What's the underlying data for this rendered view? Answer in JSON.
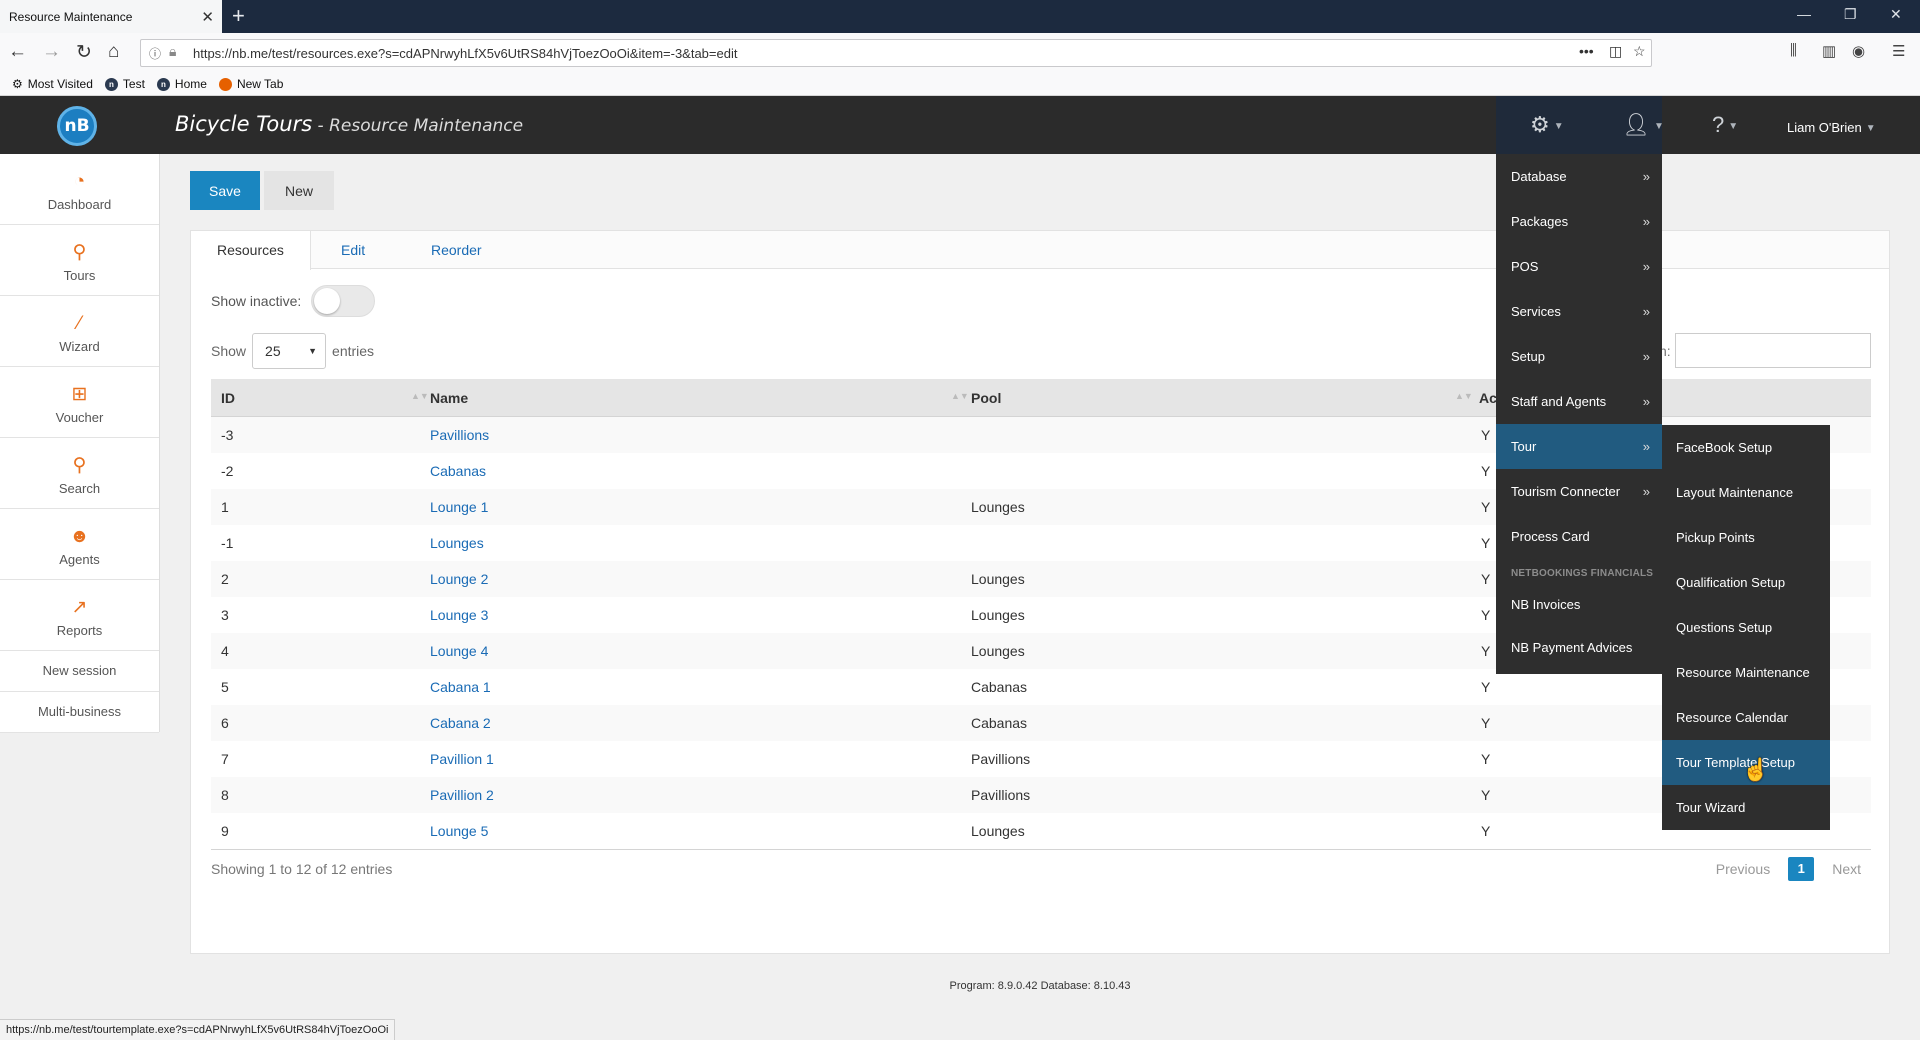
{
  "browser": {
    "tab_title": "Resource Maintenance",
    "url": "https://nb.me/test/resources.exe?s=cdAPNrwyhLfX5v6UtRS84hVjToezOoOi&item=-3&tab=edit",
    "bookmarks": [
      "Most Visited",
      "Test",
      "Home",
      "New Tab"
    ],
    "status_url": "https://nb.me/test/tourtemplate.exe?s=cdAPNrwyhLfX5v6UtRS84hVjToezOoOi"
  },
  "header": {
    "logo": "nB",
    "title_main": "Bicycle Tours",
    "title_sep": " - ",
    "title_sub": "Resource Maintenance",
    "user_name": "Liam O'Brien"
  },
  "sidebar": {
    "items": [
      {
        "label": "Dashboard",
        "icon": "gauge-icon"
      },
      {
        "label": "Tours",
        "icon": "cyclist-icon"
      },
      {
        "label": "Wizard",
        "icon": "magic-wand-icon"
      },
      {
        "label": "Voucher",
        "icon": "gift-icon"
      },
      {
        "label": "Search",
        "icon": "search-icon"
      },
      {
        "label": "Agents",
        "icon": "agent-icon"
      },
      {
        "label": "Reports",
        "icon": "chart-icon"
      }
    ],
    "links": [
      "New session",
      "Multi-business"
    ]
  },
  "actions": {
    "save": "Save",
    "new": "New"
  },
  "tabs": [
    "Resources",
    "Edit",
    "Reorder"
  ],
  "filters": {
    "show_inactive_label": "Show inactive:",
    "show_label": "Show",
    "entries_value": "25",
    "entries_label": "entries",
    "search_label_fragment": "h:"
  },
  "table": {
    "columns": [
      "ID",
      "Name",
      "Pool",
      "Ac"
    ],
    "rows": [
      {
        "id": "-3",
        "name": "Pavillions",
        "pool": "",
        "active": "Y"
      },
      {
        "id": "-2",
        "name": "Cabanas",
        "pool": "",
        "active": "Y"
      },
      {
        "id": "1",
        "name": "Lounge 1",
        "pool": "Lounges",
        "active": "Y"
      },
      {
        "id": "-1",
        "name": "Lounges",
        "pool": "",
        "active": "Y"
      },
      {
        "id": "2",
        "name": "Lounge 2",
        "pool": "Lounges",
        "active": "Y"
      },
      {
        "id": "3",
        "name": "Lounge 3",
        "pool": "Lounges",
        "active": "Y"
      },
      {
        "id": "4",
        "name": "Lounge 4",
        "pool": "Lounges",
        "active": "Y"
      },
      {
        "id": "5",
        "name": "Cabana 1",
        "pool": "Cabanas",
        "active": "Y"
      },
      {
        "id": "6",
        "name": "Cabana 2",
        "pool": "Cabanas",
        "active": "Y"
      },
      {
        "id": "7",
        "name": "Pavillion 1",
        "pool": "Pavillions",
        "active": "Y"
      },
      {
        "id": "8",
        "name": "Pavillion 2",
        "pool": "Pavillions",
        "active": "Y"
      },
      {
        "id": "9",
        "name": "Lounge 5",
        "pool": "Lounges",
        "active": "Y"
      }
    ],
    "info": "Showing 1 to 12 of 12 entries",
    "prev": "Previous",
    "page": "1",
    "next": "Next"
  },
  "menu": {
    "items": [
      {
        "label": "Database",
        "arrow": "»"
      },
      {
        "label": "Packages",
        "arrow": "»"
      },
      {
        "label": "POS",
        "arrow": "»"
      },
      {
        "label": "Services",
        "arrow": "»"
      },
      {
        "label": "Setup",
        "arrow": "»"
      },
      {
        "label": "Staff and Agents",
        "arrow": "»"
      },
      {
        "label": "Tour",
        "arrow": "»"
      },
      {
        "label": "Tourism Connecter",
        "arrow": "»"
      },
      {
        "label": "Process Card",
        "arrow": ""
      }
    ],
    "section_header": "NETBOOKINGS FINANCIALS",
    "financial_items": [
      "NB Invoices",
      "NB Payment Advices"
    ],
    "submenu": [
      "FaceBook Setup",
      "Layout Maintenance",
      "Pickup Points",
      "Qualification Setup",
      "Questions Setup",
      "Resource Maintenance",
      "Resource Calendar",
      "Tour Template Setup",
      "Tour Wizard"
    ]
  },
  "footer": {
    "version": "Program: 8.9.0.42 Database: 8.10.43"
  },
  "colors": {
    "primary": "#1a86c0",
    "menu_bg": "#2e2e2e",
    "menu_active": "#215b80",
    "sidebar_icon": "#e8711f",
    "header_bg": "#2b2b2b"
  }
}
